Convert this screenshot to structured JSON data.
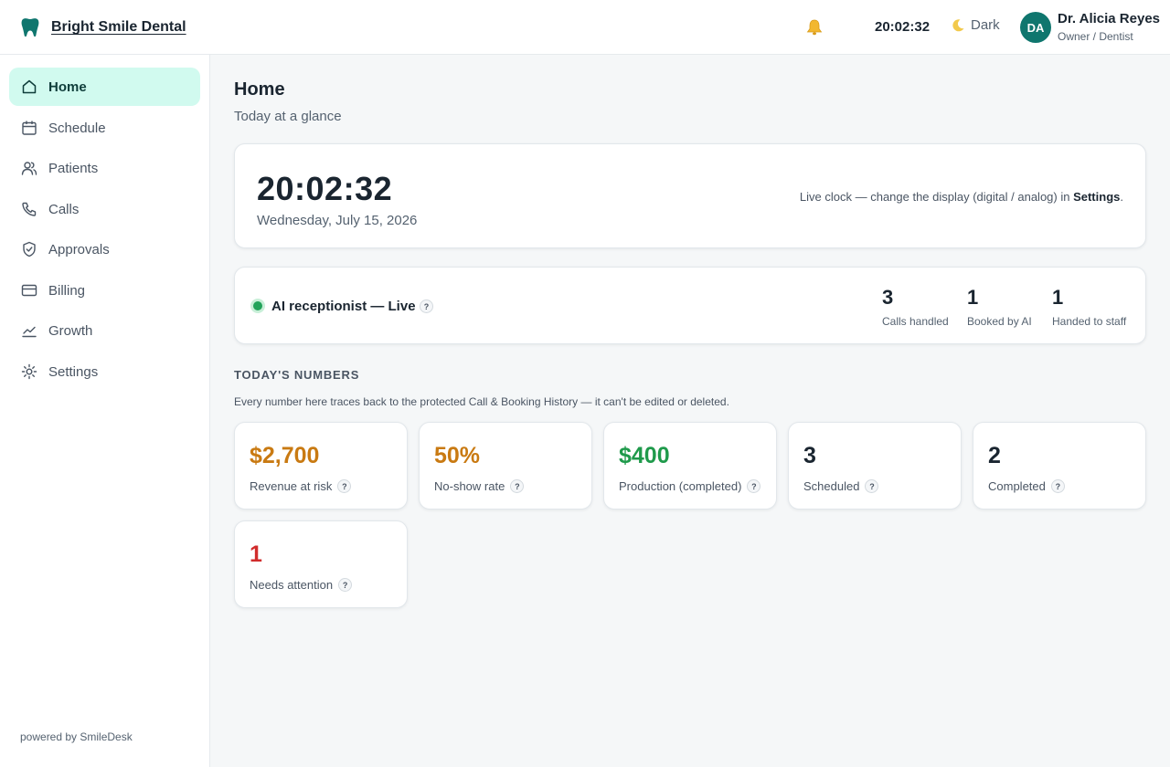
{
  "header": {
    "brand": "Bright Smile Dental",
    "clock": "20:02:32",
    "theme_label": "Dark",
    "user": {
      "initials": "DA",
      "name": "Dr. Alicia Reyes",
      "role": "Owner / Dentist"
    }
  },
  "sidebar": {
    "items": [
      {
        "label": "Home",
        "icon": "home-icon",
        "active": true
      },
      {
        "label": "Schedule",
        "icon": "calendar-icon"
      },
      {
        "label": "Patients",
        "icon": "users-icon"
      },
      {
        "label": "Calls",
        "icon": "phone-icon"
      },
      {
        "label": "Approvals",
        "icon": "shield-check-icon"
      },
      {
        "label": "Billing",
        "icon": "credit-card-icon"
      },
      {
        "label": "Growth",
        "icon": "trend-chart-icon"
      },
      {
        "label": "Settings",
        "icon": "gear-icon"
      }
    ],
    "footer": "powered by SmileDesk"
  },
  "main": {
    "title": "Home",
    "subtitle": "Today at a glance",
    "clock_card": {
      "time": "20:02:32",
      "date": "Wednesday, July 15, 2026",
      "note_prefix": "Live clock — change the display (digital / analog) in ",
      "note_link": "Settings",
      "note_suffix": "."
    },
    "ai": {
      "title": "AI receptionist — Live",
      "help": "?",
      "stats": [
        {
          "value": "3",
          "label": "Calls handled"
        },
        {
          "value": "1",
          "label": "Booked by AI"
        },
        {
          "value": "1",
          "label": "Handed to staff"
        }
      ]
    },
    "numbers": {
      "heading": "TODAY'S NUMBERS",
      "note": "Every number here traces back to the protected Call & Booking History — it can't be edited or deleted.",
      "metrics": [
        {
          "value": "$2,700",
          "label": "Revenue at risk",
          "color": "#c97a12"
        },
        {
          "value": "50%",
          "label": "No-show rate",
          "color": "#c97a12"
        },
        {
          "value": "$400",
          "label": "Production (completed)",
          "color": "#1f9a4b"
        },
        {
          "value": "3",
          "label": "Scheduled",
          "color": "#1a2530"
        },
        {
          "value": "2",
          "label": "Completed",
          "color": "#1a2530"
        },
        {
          "value": "1",
          "label": "Needs attention",
          "color": "#d12c2c"
        }
      ]
    }
  },
  "colors": {
    "accent": "#0f766e",
    "active_bg": "#d1faef",
    "live": "#22a35a"
  }
}
